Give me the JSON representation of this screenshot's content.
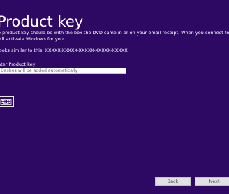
{
  "colors": {
    "background": "#2d0963",
    "text": "#ffffff",
    "input_background": "#ffffff",
    "input_placeholder": "#6d6d6d",
    "button_background": "#e1e1e1",
    "button_text": "#4a4a4a"
  },
  "page": {
    "title": "Product key",
    "description_line1": "e product key should be with the box the DVD came in or on your email receipt. When you connect to the Internet,",
    "description_line2": "e'll activate Windows for you.",
    "example": "looks similar to this: XXXXX-XXXXX-XXXXX-XXXXX-XXXXX"
  },
  "product_key": {
    "label": "nter Product key",
    "value": "",
    "placeholder": "Dashes will be added automatically"
  },
  "keyboard_button": {
    "icon": "keyboard-icon"
  },
  "footer": {
    "back_label": "Back",
    "next_label": "Next"
  }
}
